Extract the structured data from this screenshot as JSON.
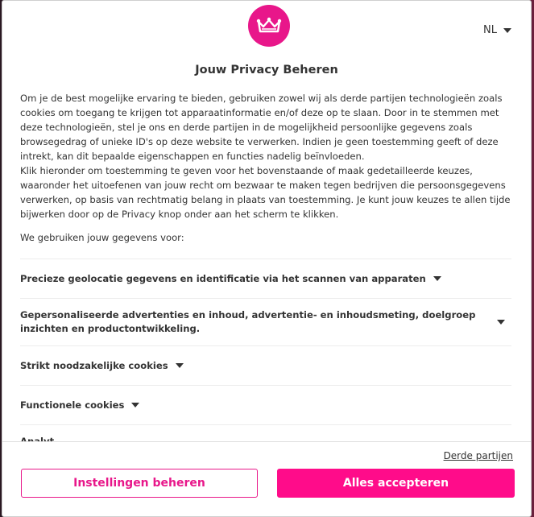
{
  "header": {
    "language": "NL",
    "title": "Jouw Privacy Beheren"
  },
  "intro": {
    "p1": "Om je de best mogelijke ervaring te bieden, gebruiken zowel wij als derde partijen technologieën zoals cookies om toegang te krijgen tot apparaatinformatie en/of deze op te slaan. Door in te stemmen met deze technologieën, stel je ons en derde partijen in de mogelijkheid persoonlijke gegevens zoals browsegedrag of unieke ID's op deze website te verwerken. Indien je geen toestemming geeft of deze intrekt, kan dit bepaalde eigenschappen en functies nadelig beïnvloeden.",
    "p2": "Klik hieronder om toestemming te geven voor het bovenstaande of maak gedetailleerde keuzes, waaronder het uitoefenen van jouw recht om bezwaar te maken tegen bedrijven die persoonsgegevens verwerken, op basis van rechtmatig belang in plaats van toestemming. Je kunt jouw keuzes te allen tijde bijwerken door op de Privacy knop onder aan het scherm te klikken."
  },
  "uses_heading": "We gebruiken jouw gegevens voor:",
  "purposes": [
    "Precieze geolocatie gegevens en identificatie via het scannen van apparaten",
    "Gepersonaliseerde advertenties en inhoud, advertentie- en inhoudsmeting, doelgroep inzichten en productontwikkeling.",
    "Strikt noodzakelijke cookies",
    "Functionele cookies",
    "Analyt..."
  ],
  "footer": {
    "third_parties": "Derde partijen",
    "settings_button": "Instellingen beheren",
    "accept_button": "Alles accepteren"
  },
  "colors": {
    "brand_pink": "#e8178a",
    "accept_pink": "#ff0c8a"
  },
  "icons": {
    "logo": "crown-icon",
    "dropdown": "caret-down-icon"
  }
}
